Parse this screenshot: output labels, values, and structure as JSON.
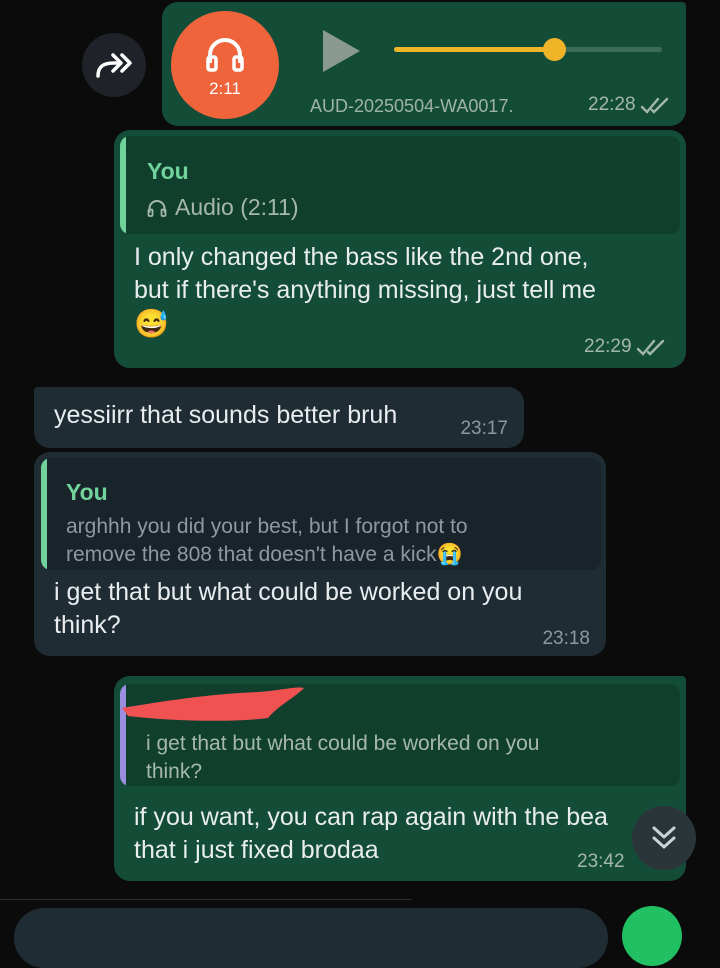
{
  "colors": {
    "background": "#0b0b0b",
    "outgoing_bubble": "#144d37",
    "incoming_bubble": "#1f2c33",
    "quote_author_you": "#71d39b",
    "audio_progress": "#f0b429",
    "audio_avatar": "#f0643c",
    "quote_bar_purple": "#9b8ee0",
    "scribble_red": "#f05252"
  },
  "audio_message": {
    "duration": "2:11",
    "filename": "AUD-20250504-WA0017.",
    "time": "22:28",
    "progress": 0.6,
    "icons": [
      "forward-icon",
      "headphones-icon",
      "play-icon",
      "double-check-icon"
    ]
  },
  "reply_message_1": {
    "quote_author": "You",
    "quote_text": "Audio (2:11)",
    "line1": "I only changed the bass like the 2nd one,",
    "line2": "but if there's anything missing, just tell me",
    "emoji": "😅",
    "time": "22:29"
  },
  "incoming_message_1": {
    "text": "yessiirr that sounds better bruh",
    "time": "23:17"
  },
  "incoming_message_2": {
    "quote_author": "You",
    "quote_line1": "arghhh you did your best, but I forgot not to",
    "quote_line2": "remove the 808 that doesn't have a kick",
    "quote_emoji": "😭",
    "line1": "i get that but what could be worked on you",
    "line2": "think?",
    "time": "23:18"
  },
  "reply_message_2": {
    "quote_line1": "i get that but what could be worked on you",
    "quote_line2": "think?",
    "line1": "if you want, you can rap again with the bea",
    "line2": "that i just fixed brodaa",
    "time": "23:42"
  },
  "scroll_button": {
    "icon": "double-chevron-down-icon"
  }
}
